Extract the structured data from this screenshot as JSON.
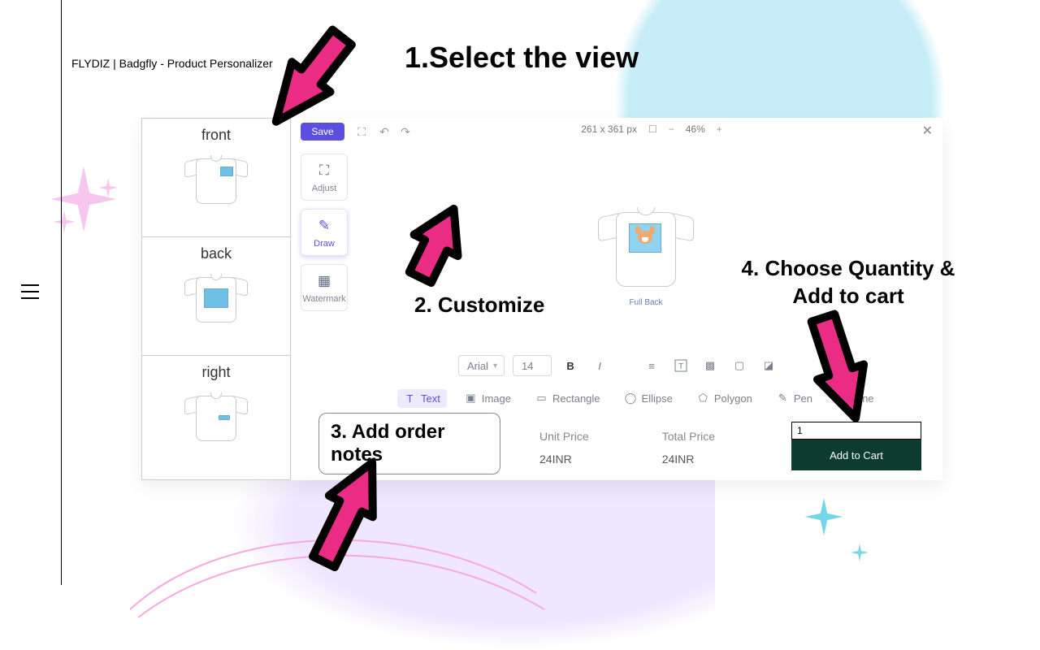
{
  "page_title": "FLYDIZ | Badgfly - Product Personalizer",
  "annotations": {
    "step1": "1.Select the view",
    "step2": "2. Customize",
    "step3": "3. Add order notes",
    "step4_line1": "4. Choose Quantity &",
    "step4_line2": "Add to cart"
  },
  "colors": {
    "accent": "#5b4fe0",
    "arrow": "#ea2c84",
    "cart": "#0d3b2e"
  },
  "editor": {
    "save_label": "Save",
    "views": [
      "front",
      "back",
      "right"
    ],
    "tools": {
      "adjust": "Adjust",
      "draw": "Draw",
      "watermark": "Watermark"
    },
    "canvas": {
      "dimensions": "261 x 361 px",
      "zoom": "46%",
      "preview_caption": "Full Back"
    },
    "fontbar": {
      "font": "Arial",
      "size": "14"
    },
    "shape_tools": {
      "text": "Text",
      "image": "Image",
      "rectangle": "Rectangle",
      "ellipse": "Ellipse",
      "polygon": "Polygon",
      "pen": "Pen",
      "line": "Line"
    },
    "pricing": {
      "unit_label": "Unit Price",
      "unit_value": "24INR",
      "total_label": "Total Price",
      "total_value": "24INR"
    },
    "quantity": "1",
    "add_to_cart": "Add to Cart"
  }
}
